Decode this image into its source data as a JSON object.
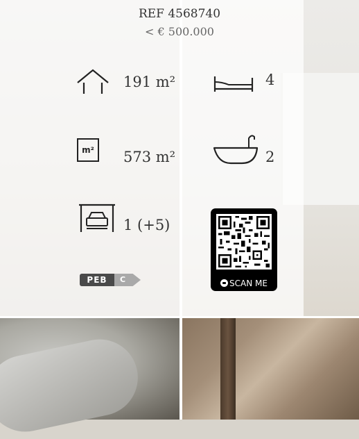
{
  "listing": {
    "reference": "REF 4568740",
    "price": "< € 500.000"
  },
  "features": {
    "living_area": "191 m²",
    "bedrooms": "4",
    "land_area_icon_text": "m²",
    "land_area": "573 m²",
    "bathrooms": "2",
    "parking": "1 (+5)"
  },
  "energy": {
    "label": "PEB",
    "rating": "C"
  },
  "qr": {
    "label": "SCAN ME"
  },
  "icons": [
    "house-icon",
    "bed-icon",
    "land-area-icon",
    "bathtub-icon",
    "garage-icon",
    "peb-badge",
    "qr-code-icon"
  ],
  "colors": {
    "text": "#333333",
    "muted": "#666666",
    "peb_dark": "#4a4a4a",
    "peb_rating": "#a9a9a9",
    "qr_bg": "#000000"
  }
}
